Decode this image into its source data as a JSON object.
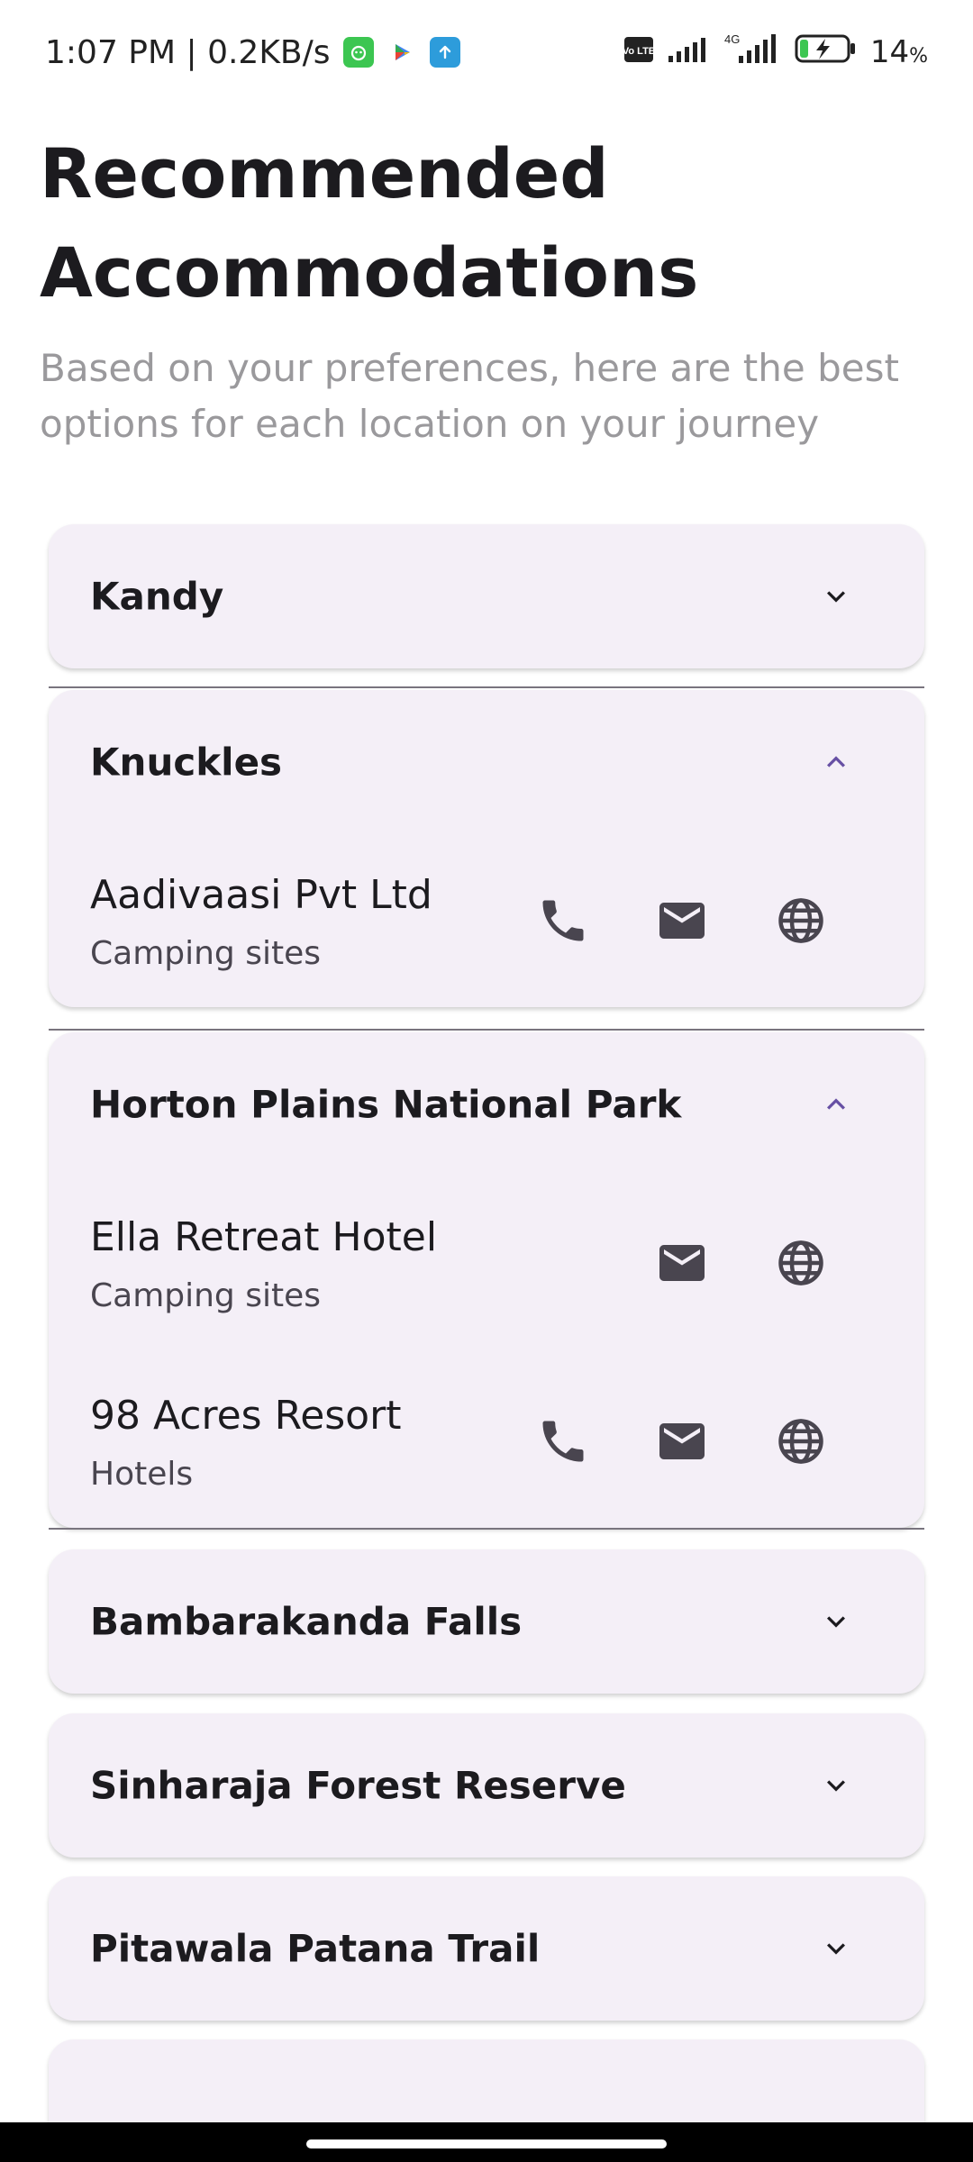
{
  "status_bar": {
    "time_speed": "1:07 PM | 0.2KB/s",
    "network_label": "4G",
    "volte_label": "Vo LTE",
    "battery_level": "14",
    "battery_unit": "%"
  },
  "page": {
    "title": "Recommended Accommodations",
    "subtitle": "Based on your preferences, here are the best options for each location on your journey"
  },
  "locations": [
    {
      "name": "Kandy",
      "expanded": false,
      "accommodations": []
    },
    {
      "name": "Knuckles",
      "expanded": true,
      "accommodations": [
        {
          "name": "Aadivaasi Pvt Ltd",
          "type": "Camping sites",
          "actions": [
            "phone-icon",
            "email-icon",
            "web-icon"
          ]
        }
      ]
    },
    {
      "name": "Horton Plains National Park",
      "expanded": true,
      "accommodations": [
        {
          "name": "Ella Retreat Hotel",
          "type": "Camping sites",
          "actions": [
            "email-icon",
            "web-icon"
          ]
        },
        {
          "name": "98 Acres Resort",
          "type": "Hotels",
          "actions": [
            "phone-icon",
            "email-icon",
            "web-icon"
          ]
        }
      ]
    },
    {
      "name": "Bambarakanda Falls",
      "expanded": false,
      "accommodations": []
    },
    {
      "name": "Sinharaja Forest Reserve",
      "expanded": false,
      "accommodations": []
    },
    {
      "name": "Pitawala Patana Trail",
      "expanded": false,
      "accommodations": []
    }
  ],
  "colors": {
    "card_background": "#f4eff7",
    "accent": "#6750a4",
    "icon": "#49454f",
    "subtitle": "#9a999c"
  }
}
